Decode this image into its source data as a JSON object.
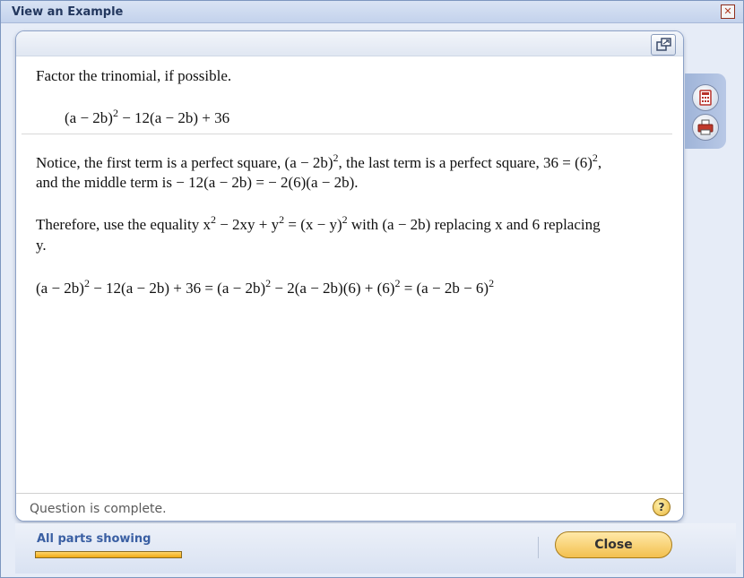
{
  "window": {
    "title": "View an Example",
    "close_glyph": "✕"
  },
  "problem": {
    "instruction": "Factor the trinomial, if possible.",
    "expr": {
      "a": "(a − 2b)",
      "b": "2",
      "c": " − 12(a − 2b) + 36"
    }
  },
  "explanation": {
    "l1": {
      "a": "Notice, the first term is a perfect square, (a − 2b)",
      "b": "2",
      "c": ", the last term is a perfect square, 36 = (6)",
      "d": "2",
      "e": ","
    },
    "l2": "and the middle term is  − 12(a − 2b) =  − 2(6)(a − 2b).",
    "l3": {
      "a": "Therefore, use the equality x",
      "b": "2",
      "c": " − 2xy + y",
      "d": "2",
      "e": " = (x − y)",
      "f": "2",
      "g": " with (a − 2b) replacing x and 6 replacing"
    },
    "l4": "y.",
    "l5": {
      "a": "(a − 2b)",
      "b": "2",
      "c": " − 12(a − 2b) + 36 = (a − 2b)",
      "d": "2",
      "e": " − 2(a − 2b)(6) + (6)",
      "f": "2",
      "g": " = (a − 2b − 6)",
      "h": "2"
    }
  },
  "status": {
    "text": "Question is complete.",
    "help_glyph": "?"
  },
  "footer": {
    "parts_label": "All parts showing",
    "progress": 1.0,
    "close_label": "Close"
  },
  "tools": [
    "calculator-icon",
    "print-icon"
  ],
  "colors": {
    "accent": "#3a5fa3",
    "button": "#f3c04f",
    "progress": "#f0a913"
  }
}
